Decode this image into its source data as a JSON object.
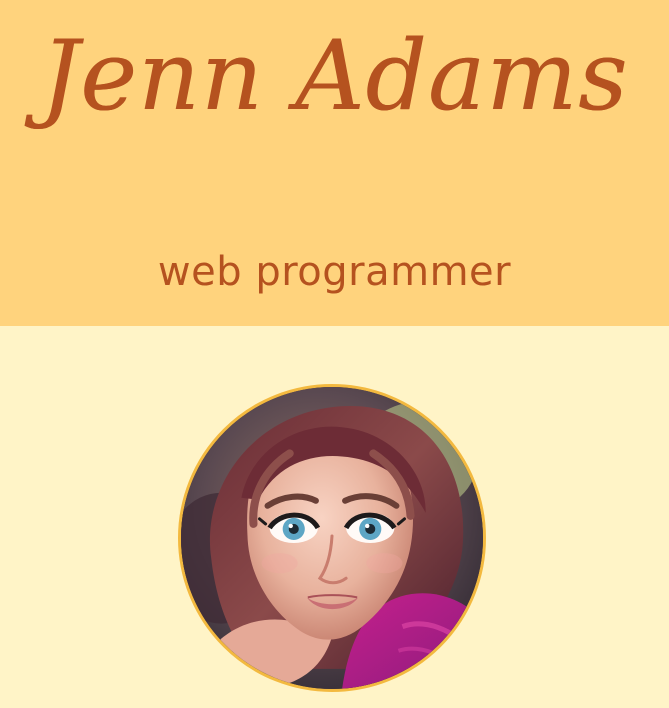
{
  "header": {
    "name": "Jenn Adams",
    "subtitle": "web programmer"
  },
  "profile": {
    "avatar_icon": "avatar-portrait"
  }
}
